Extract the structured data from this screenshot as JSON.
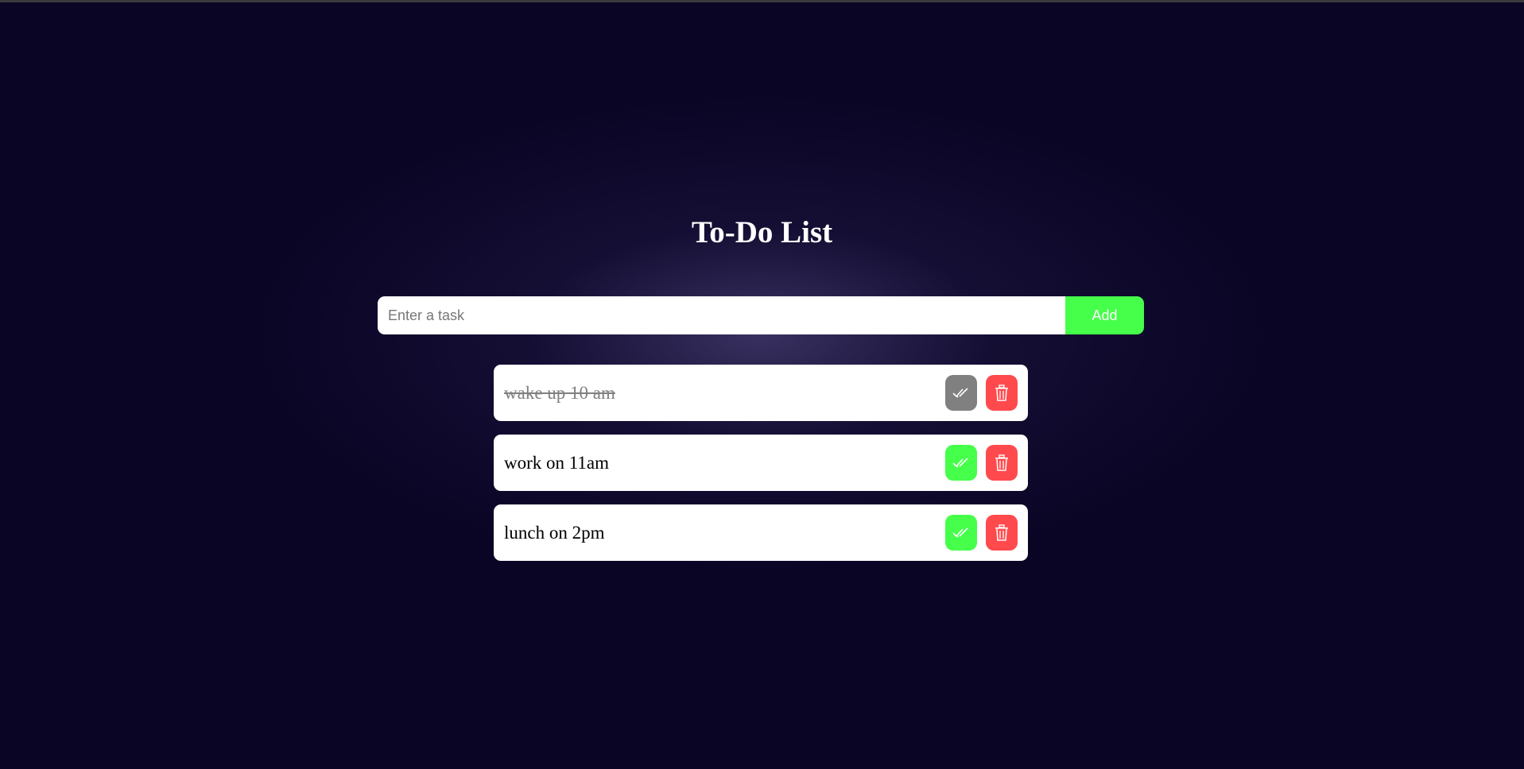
{
  "app": {
    "title": "To-Do List"
  },
  "input": {
    "placeholder": "Enter a task",
    "value": ""
  },
  "add_button": {
    "label": "Add"
  },
  "tasks": [
    {
      "text": "wake up 10 am",
      "completed": true
    },
    {
      "text": "work on 11am",
      "completed": false
    },
    {
      "text": "lunch on 2pm",
      "completed": false
    }
  ],
  "icons": {
    "complete": "double-check-icon",
    "delete": "trash-icon"
  },
  "colors": {
    "background": "#0a0525",
    "accent": "#45ff4a",
    "danger": "#ff4a4d",
    "completed_gray": "#808080"
  }
}
